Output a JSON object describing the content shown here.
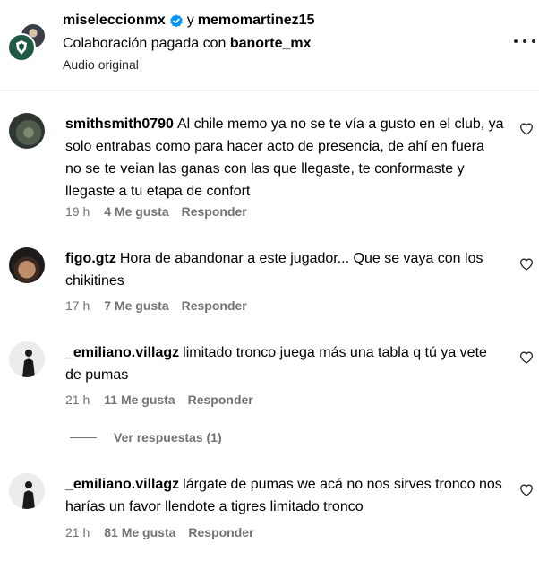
{
  "header": {
    "user1": "miseleccionmx",
    "connector": "y",
    "user2": "memomartinez15",
    "paid_prefix": "Colaboración pagada con",
    "paid_brand": "banorte_mx",
    "audio": "Audio original"
  },
  "comments": [
    {
      "user": "smithsmith0790",
      "text": "Al chile memo ya no se te vía a gusto en el club, ya solo entrabas como para hacer acto de presencia, de ahí en fuera no se te veian las ganas con las que llegaste, te conformaste y llegaste a tu etapa de confort",
      "time": "19 h",
      "likes": "4 Me gusta",
      "reply": "Responder"
    },
    {
      "user": "figo.gtz",
      "text": "Hora de abandonar a este jugador... Que se vaya con los chikitines",
      "time": "17 h",
      "likes": "7 Me gusta",
      "reply": "Responder"
    },
    {
      "user": "_emiliano.villagz",
      "text": "limitado tronco juega más una tabla q tú ya vete de pumas",
      "time": "21 h",
      "likes": "11 Me gusta",
      "reply": "Responder"
    },
    {
      "user": "_emiliano.villagz",
      "text": "lárgate de pumas we acá no nos sirves tronco nos harías un favor llendote a tigres limitado tronco",
      "time": "21 h",
      "likes": "81 Me gusta",
      "reply": "Responder"
    }
  ],
  "view_replies": "Ver respuestas (1)",
  "icons": {
    "verified": "verified-badge-icon",
    "more": "more-options-icon",
    "like": "heart-outline-icon"
  },
  "colors": {
    "verified_blue": "#0095f6",
    "secondary_text": "#737373",
    "divider": "#efefef"
  }
}
